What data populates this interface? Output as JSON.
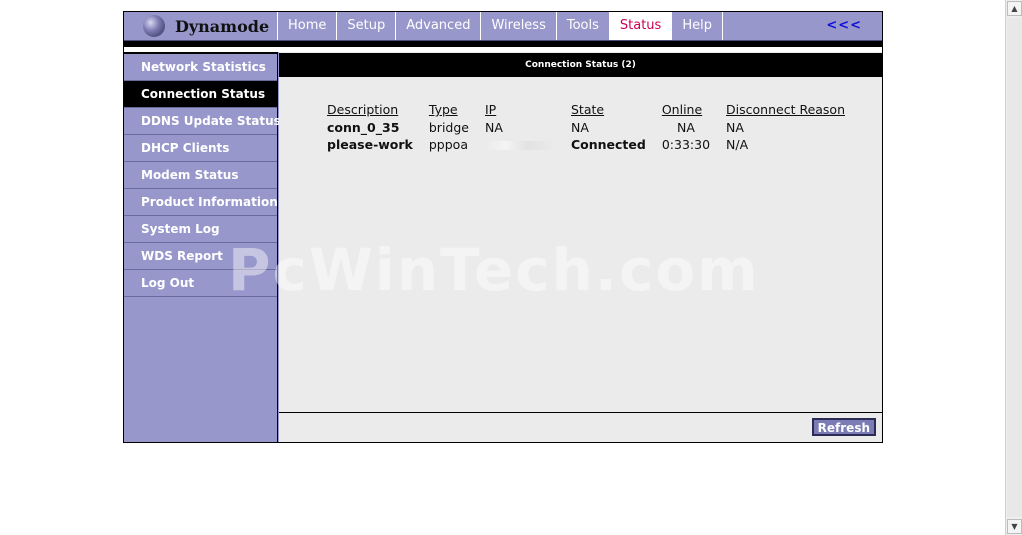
{
  "brand": {
    "name": "Dynamode"
  },
  "topnav": {
    "tabs": [
      {
        "label": "Home"
      },
      {
        "label": "Setup"
      },
      {
        "label": "Advanced"
      },
      {
        "label": "Wireless"
      },
      {
        "label": "Tools"
      },
      {
        "label": "Status",
        "active": true
      },
      {
        "label": "Help"
      }
    ],
    "back_label": "<<<"
  },
  "sidebar": {
    "items": [
      {
        "label": "Network Statistics"
      },
      {
        "label": "Connection Status",
        "active": true
      },
      {
        "label": "DDNS Update Status"
      },
      {
        "label": "DHCP Clients"
      },
      {
        "label": "Modem Status"
      },
      {
        "label": "Product Information"
      },
      {
        "label": "System Log"
      },
      {
        "label": "WDS Report"
      },
      {
        "label": "Log Out"
      }
    ]
  },
  "content": {
    "title": "Connection Status (2)",
    "table": {
      "headers": [
        "Description",
        "Type",
        "IP",
        "State",
        "Online",
        "Disconnect Reason"
      ],
      "rows": [
        [
          "conn_0_35",
          "bridge",
          "NA",
          "NA",
          "NA",
          "NA"
        ],
        [
          "please-work",
          "pppoa",
          "",
          "Connected",
          "0:33:30",
          "N/A"
        ]
      ]
    },
    "refresh_label": "Refresh"
  },
  "watermark": "PcWinTech.com",
  "colors": {
    "nav_bg": "#9797cb",
    "active_tab_text": "#cc0055",
    "content_bg": "#ebebeb",
    "header_bg": "#000000"
  }
}
